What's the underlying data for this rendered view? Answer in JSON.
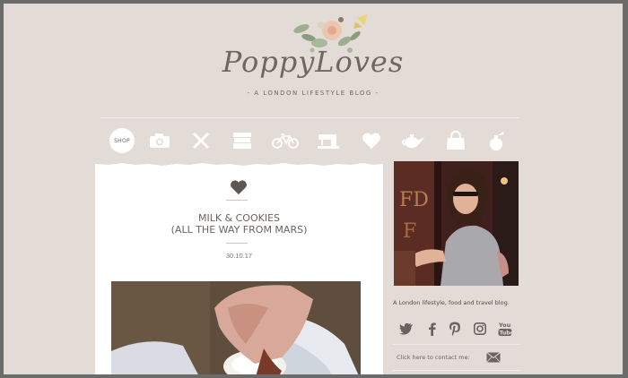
{
  "header": {
    "title": "PoppyLoves",
    "tagline": "-  A LONDON LIFESTYLE BLOG  -"
  },
  "nav": {
    "items": [
      {
        "label": "SHOP",
        "icon": "shop"
      },
      {
        "icon": "camera-icon"
      },
      {
        "icon": "cutlery-icon"
      },
      {
        "icon": "books-icon"
      },
      {
        "icon": "bicycle-icon"
      },
      {
        "icon": "sewing-machine-icon"
      },
      {
        "icon": "heart-icon"
      },
      {
        "icon": "teapot-icon"
      },
      {
        "icon": "handbag-icon"
      },
      {
        "icon": "perfume-icon"
      }
    ]
  },
  "post": {
    "title_line1": "MILK & COOKIES",
    "title_line2": "(ALL THE WAY FROM MARS)",
    "date": "30.10.17"
  },
  "sidebar": {
    "description": "A London lifestyle, food and travel blog.",
    "social": [
      "twitter-icon",
      "facebook-icon",
      "pinterest-icon",
      "instagram-icon",
      "youtube-icon"
    ],
    "contact_label": "Click here to contact me:"
  },
  "colors": {
    "background": "#e3dcd6",
    "icon": "#ffffff",
    "text": "#6a6460"
  }
}
